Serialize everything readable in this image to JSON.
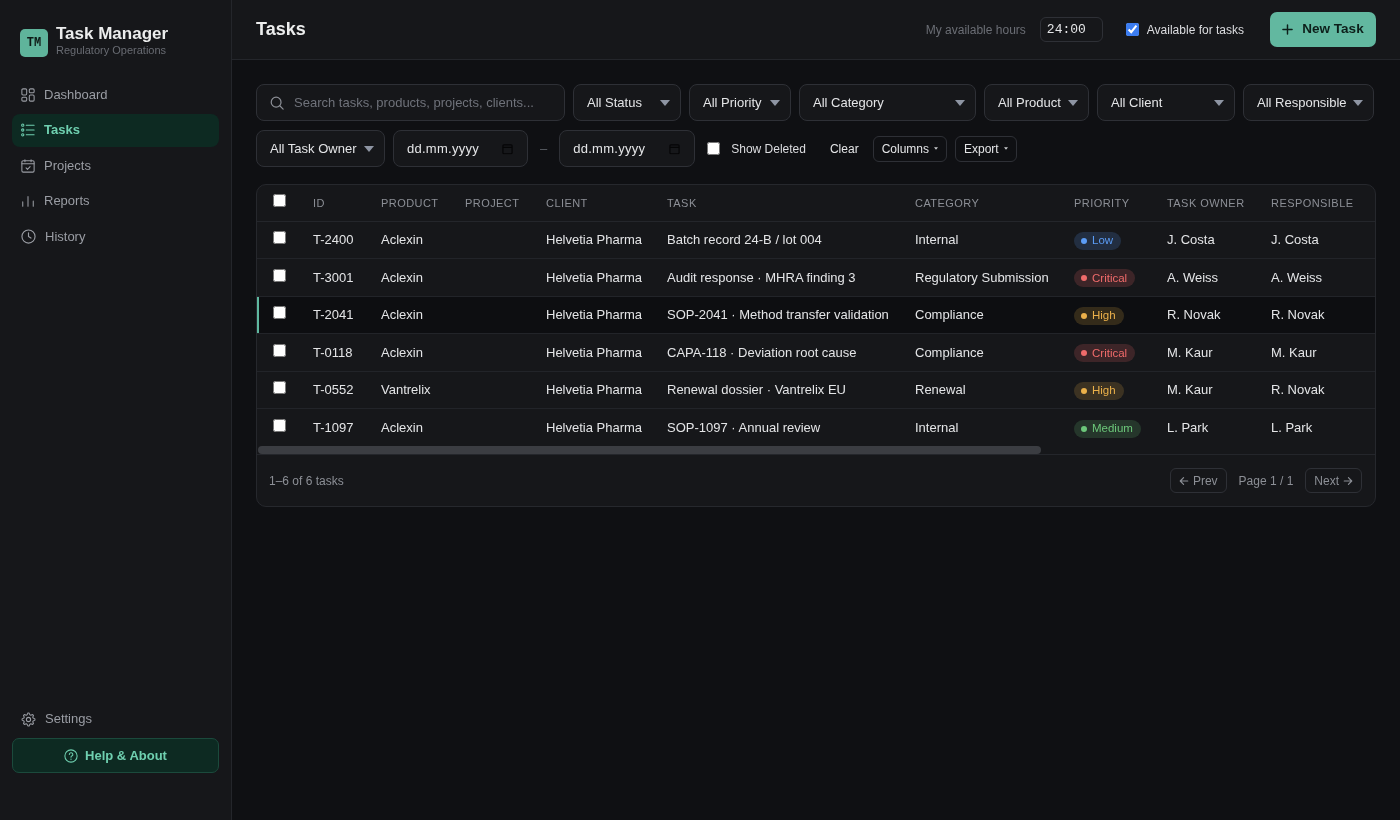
{
  "sidebar": {
    "logo": "TM",
    "title": "Task Manager",
    "subtitle": "Regulatory Operations",
    "nav": [
      {
        "label": "Dashboard",
        "kind": "grid",
        "selected": false
      },
      {
        "label": "Tasks",
        "kind": "list",
        "selected": true
      },
      {
        "label": "Projects",
        "kind": "calendar",
        "selected": false
      },
      {
        "label": "Reports",
        "kind": "chart",
        "selected": false
      },
      {
        "label": "History",
        "kind": "clock",
        "selected": false
      }
    ],
    "settings": "Settings",
    "help_button": "Help & About"
  },
  "header": {
    "title": "Tasks",
    "hours_label": "My available hours",
    "hours_value": "24:00",
    "available": {
      "label": "Available for tasks",
      "checked": true
    },
    "new_task_button": "New Task"
  },
  "filters": {
    "search": {
      "placeholder": "Search tasks, products, projects, clients..."
    },
    "selects": [
      "All Status",
      "All Priority",
      "All Category",
      "All Product",
      "All Client",
      "All Responsible",
      "All Task Owner"
    ],
    "date_from": {
      "placeholder": "dd.mm.yyyy"
    },
    "date_separator": "–",
    "date_to": {
      "placeholder": "dd.mm.yyyy"
    },
    "show_deleted": {
      "label": "Show Deleted",
      "checked": false
    },
    "clear_button": "Clear",
    "columns_button": "Columns",
    "export_button": "Export"
  },
  "table": {
    "select_all_checked": false,
    "columns": [
      "ID",
      "PRODUCT",
      "PROJECT",
      "CLIENT",
      "TASK",
      "CATEGORY",
      "PRIORITY",
      "TASK OWNER",
      "RESPONSIBLE"
    ],
    "rows": [
      {
        "checked": false,
        "selected": false,
        "id": "T-2400",
        "product": "Aclexin",
        "client": "Helvetia Pharma",
        "task": "Batch record 24-B / lot 004",
        "category": "Internal",
        "priority": {
          "label": "Low",
          "color": "#5b9cf5"
        },
        "task_owner": "J. Costa",
        "responsible": "J. Costa"
      },
      {
        "checked": false,
        "selected": false,
        "id": "T-3001",
        "product": "Aclexin",
        "client": "Helvetia Pharma",
        "task": "Audit response · MHRA finding 3",
        "category": "Regulatory Submission",
        "priority": {
          "label": "Critical",
          "color": "#f06b6b"
        },
        "task_owner": "A. Weiss",
        "responsible": "A. Weiss"
      },
      {
        "checked": false,
        "selected": true,
        "id": "T-2041",
        "product": "Aclexin",
        "client": "Helvetia Pharma",
        "task": "SOP-2041 · Method transfer validation",
        "category": "Compliance",
        "priority": {
          "label": "High",
          "color": "#ebb04a"
        },
        "task_owner": "R. Novak",
        "responsible": "R. Novak"
      },
      {
        "checked": false,
        "selected": false,
        "id": "T-0118",
        "product": "Aclexin",
        "client": "Helvetia Pharma",
        "task": "CAPA-118 · Deviation root cause",
        "category": "Compliance",
        "priority": {
          "label": "Critical",
          "color": "#f06b6b"
        },
        "task_owner": "M. Kaur",
        "responsible": "M. Kaur"
      },
      {
        "checked": false,
        "selected": false,
        "id": "T-0552",
        "product": "Vantrelix",
        "client": "Helvetia Pharma",
        "task": "Renewal dossier · Vantrelix EU",
        "category": "Renewal",
        "priority": {
          "label": "High",
          "color": "#ebb04a"
        },
        "task_owner": "M. Kaur",
        "responsible": "R. Novak"
      },
      {
        "checked": false,
        "selected": false,
        "id": "T-1097",
        "product": "Aclexin",
        "client": "Helvetia Pharma",
        "task": "SOP-1097 · Annual review",
        "category": "Internal",
        "priority": {
          "label": "Medium",
          "color": "#6cc77a"
        },
        "task_owner": "L. Park",
        "responsible": "L. Park"
      }
    ]
  },
  "footer": {
    "summary": "1–6 of 6 tasks",
    "prev_button": "Prev",
    "page_label": "Page 1 / 1",
    "next_button": "Next"
  }
}
